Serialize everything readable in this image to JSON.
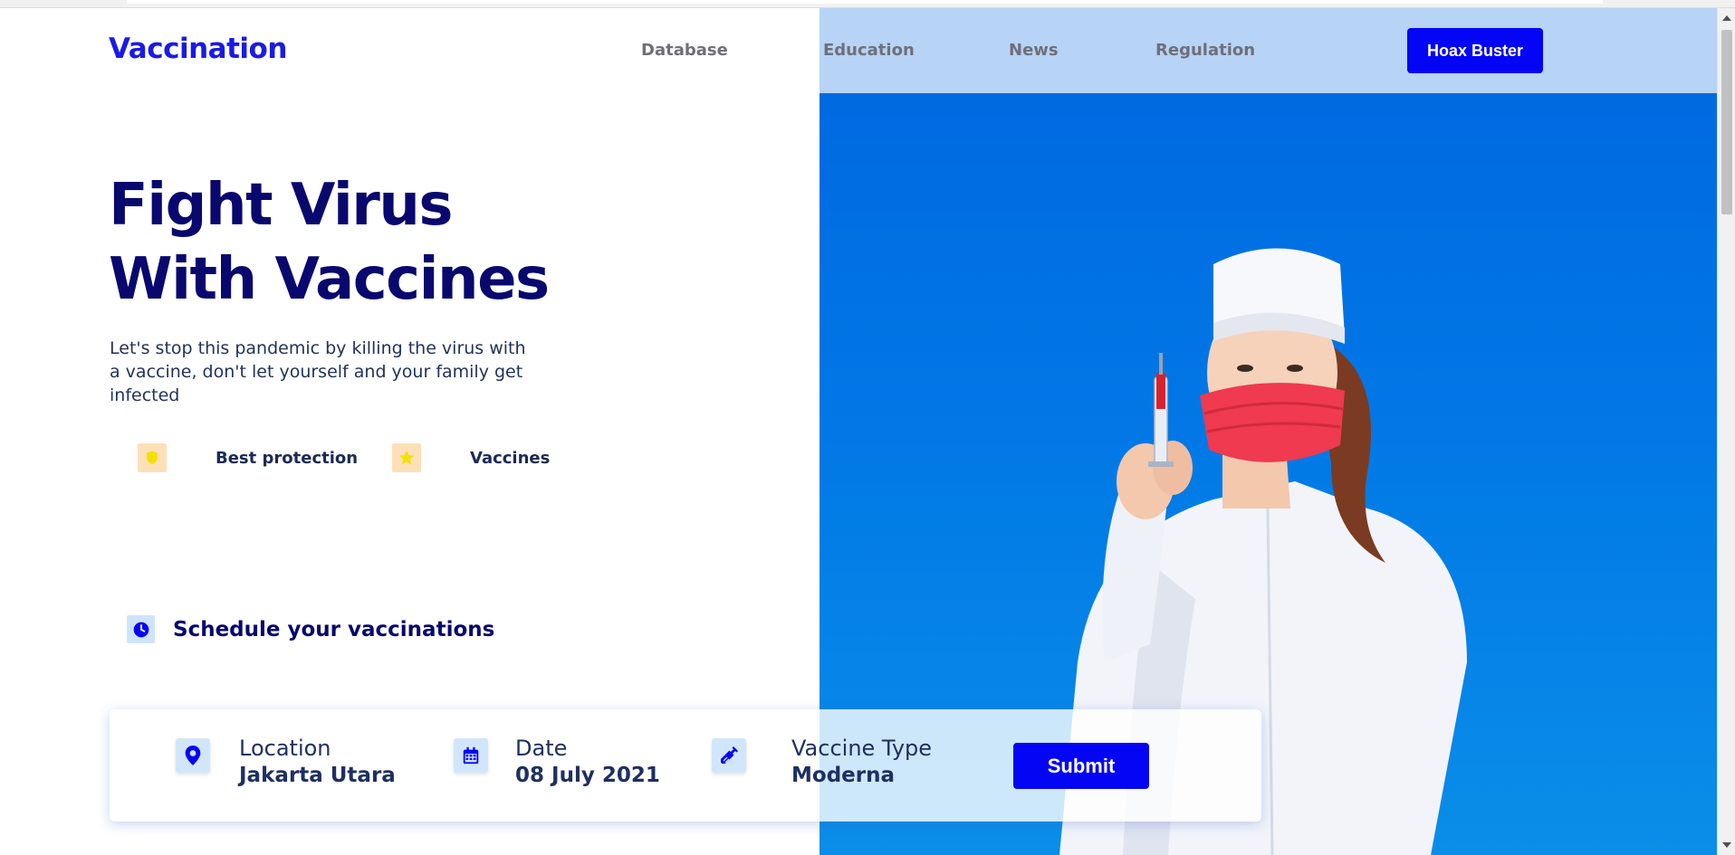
{
  "brand": {
    "name": "Vaccination",
    "accent": "#0505f5",
    "dark_navy": "#08086e",
    "hero_blue": "#0178e6"
  },
  "nav": {
    "items": [
      {
        "label": "Database"
      },
      {
        "label": "Education"
      },
      {
        "label": "News"
      },
      {
        "label": "Regulation"
      }
    ],
    "cta_label": "Hoax Buster"
  },
  "hero": {
    "headline_line1": "Fight Virus",
    "headline_line2": "With Vaccines",
    "subtext": "Let's stop this pandemic by killing the virus with a vaccine, don't let yourself and your family get infected",
    "features": [
      {
        "icon": "shield-icon",
        "label": "Best protection"
      },
      {
        "icon": "star-icon",
        "label": "Vaccines"
      }
    ],
    "image": "nurse-holding-syringe"
  },
  "schedule": {
    "icon": "clock-icon",
    "title": "Schedule your vaccinations",
    "fields": [
      {
        "icon": "location-pin-icon",
        "label": "Location",
        "value": "Jakarta Utara"
      },
      {
        "icon": "calendar-icon",
        "label": "Date",
        "value": "08 July 2021"
      },
      {
        "icon": "syringe-icon",
        "label": "Vaccine Type",
        "value": "Moderna"
      }
    ],
    "submit_label": "Submit"
  }
}
